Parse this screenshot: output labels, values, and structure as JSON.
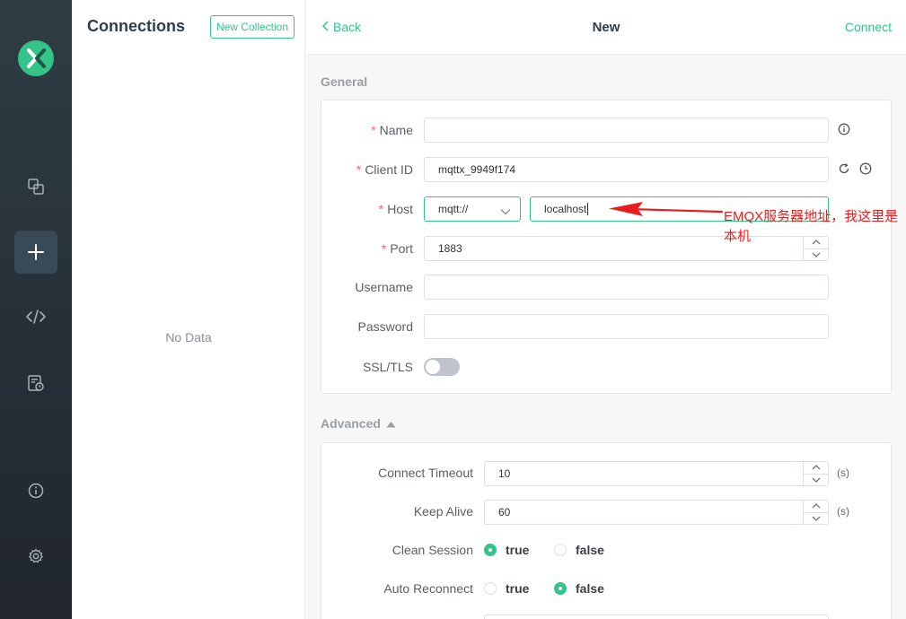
{
  "rail": {
    "items": [
      {
        "name": "connections-icon"
      },
      {
        "name": "new-connection-icon"
      },
      {
        "name": "script-icon"
      },
      {
        "name": "log-icon"
      },
      {
        "name": "about-icon"
      },
      {
        "name": "settings-icon"
      }
    ],
    "accent": "#34c388"
  },
  "connections": {
    "title": "Connections",
    "new_collection_label": "New Collection",
    "empty_text": "No Data"
  },
  "topbar": {
    "back_label": "Back",
    "title": "New",
    "connect_label": "Connect"
  },
  "general": {
    "section_label": "General",
    "name": {
      "label": "Name",
      "required": "*",
      "value": ""
    },
    "client_id": {
      "label": "Client ID",
      "required": "*",
      "value": "mqttx_9949f174"
    },
    "host": {
      "label": "Host",
      "required": "*",
      "protocol": "mqtt://",
      "value": "localhost"
    },
    "port": {
      "label": "Port",
      "required": "*",
      "value": "1883"
    },
    "username": {
      "label": "Username",
      "value": ""
    },
    "password": {
      "label": "Password",
      "value": ""
    },
    "ssl": {
      "label": "SSL/TLS",
      "enabled": false
    }
  },
  "advanced": {
    "section_label": "Advanced",
    "connect_timeout": {
      "label": "Connect Timeout",
      "value": "10",
      "unit": "(s)"
    },
    "keep_alive": {
      "label": "Keep Alive",
      "value": "60",
      "unit": "(s)"
    },
    "clean_session": {
      "label": "Clean Session",
      "options": [
        "true",
        "false"
      ],
      "selected": "true"
    },
    "auto_reconnect": {
      "label": "Auto Reconnect",
      "options": [
        "true",
        "false"
      ],
      "selected": "false"
    }
  },
  "annotation": {
    "text": "EMQX服务器地址，我这里是本机",
    "color": "#e81e1e"
  }
}
